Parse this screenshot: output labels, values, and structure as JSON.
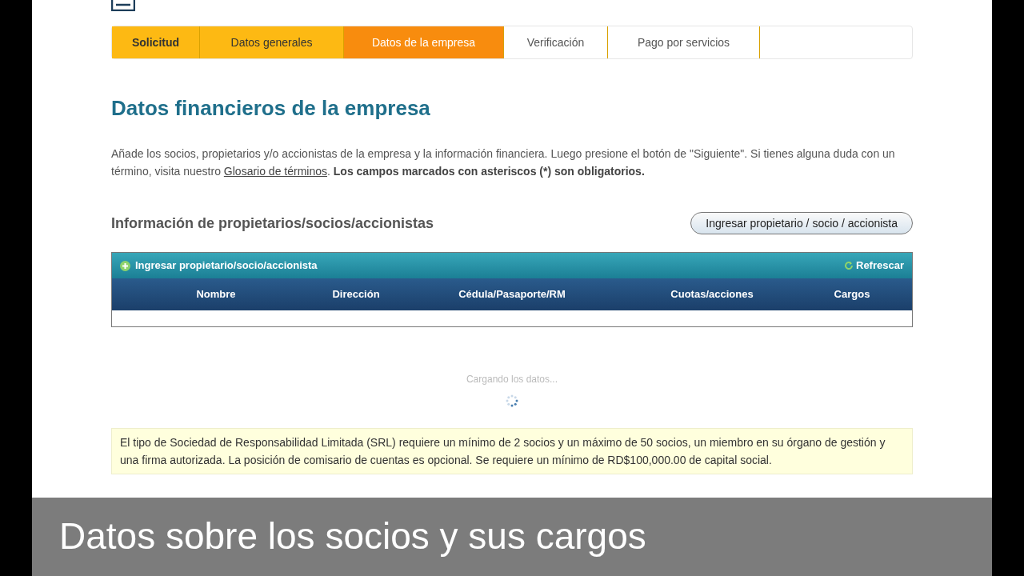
{
  "steps": [
    {
      "label": "Solicitud",
      "completed": true,
      "selected": false
    },
    {
      "label": "Datos generales",
      "completed": true,
      "selected": false
    },
    {
      "label": "Datos de la empresa",
      "completed": false,
      "selected": true
    },
    {
      "label": "Verificación",
      "completed": false,
      "selected": false
    },
    {
      "label": "Pago por servicios",
      "completed": false,
      "selected": false
    }
  ],
  "heading": "Datos financieros de la empresa",
  "intro": {
    "text": "Añade los socios, propietarios y/o accionistas de la empresa y la información financiera. Luego presione el botón de \"Siguiente\". Si tienes alguna duda con un término, visita nuestro",
    "link": "Glosario de términos",
    "after": ".",
    "required_note": "Los campos marcados con asteriscos (*) son obligatorios."
  },
  "owners": {
    "title": "Información de propietarios/socios/accionistas",
    "add_button": "Ingresar propietario / socio / accionista"
  },
  "table": {
    "toolbar_add": "Ingresar propietario/socio/accionista",
    "refresh": "Refrescar",
    "columns": [
      "Nombre",
      "Dirección",
      "Cédula/Pasaporte/RM",
      "Cuotas/acciones",
      "Cargos"
    ],
    "loading": "Cargando los datos..."
  },
  "notice": "El tipo de Sociedad de Responsabilidad Limitada (SRL) requiere un mínimo de 2 socios y un máximo de 50 socios, un miembro en su órgano de gestión y una firma autorizada. La posición de comisario de cuentas es opcional. Se requiere un mínimo de RD$100,000.00 de capital social.",
  "caption": "Datos sobre los socios y sus cargos"
}
